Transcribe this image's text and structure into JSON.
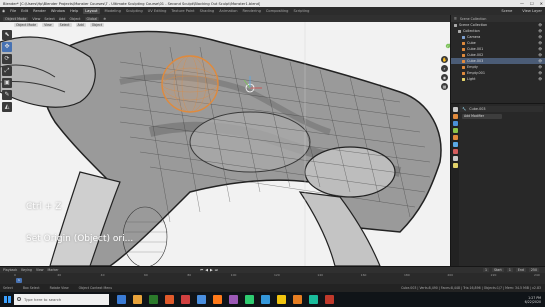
{
  "window": {
    "title": "Blender* [C:\\Users\\Hp\\Blender Projects\\Monster Courses\\7 - Ultimate Sculpting Course\\01 - Second Sculpt\\Blocking Out Sculpt\\Monster1.blend]",
    "controls": [
      "—",
      "☐",
      "✕"
    ]
  },
  "menubar": {
    "items": [
      "File",
      "Edit",
      "Render",
      "Window",
      "Help"
    ],
    "workspaces": [
      "Layout",
      "Modeling",
      "Sculpting",
      "UV Editing",
      "Texture Paint",
      "Shading",
      "Animation",
      "Rendering",
      "Compositing",
      "Scripting"
    ],
    "active_workspace": "Layout",
    "scene": "Scene",
    "view_layer": "View Layer"
  },
  "header2": {
    "mode": "Object Mode",
    "view": "View",
    "select": "Select",
    "add": "Add",
    "object": "Object",
    "orientation": "Global",
    "transform": "⊕"
  },
  "viewport": {
    "header": [
      "Object Mode",
      "View",
      "Select",
      "Add",
      "Object"
    ],
    "tools": [
      "⬉",
      "✥",
      "⟳",
      "⤢",
      "▣",
      "✎",
      "◭"
    ],
    "overlay_shortcut": "Ctrl + Z",
    "overlay_operation": "Set Origin (Object) ori...",
    "nav": [
      "✋",
      "⌕",
      "◉",
      "▦"
    ],
    "gizmo_axes": [
      "X",
      "Y",
      "Z"
    ]
  },
  "outliner": {
    "header": [
      "Scene Collection"
    ],
    "rows": [
      {
        "label": "Scene Collection",
        "type": "col",
        "indent": 0,
        "selected": false
      },
      {
        "label": "Collection",
        "type": "col",
        "indent": 1,
        "selected": false
      },
      {
        "label": "Camera",
        "type": "cam",
        "indent": 2,
        "selected": false
      },
      {
        "label": "Cube",
        "type": "mesh",
        "indent": 2,
        "selected": false
      },
      {
        "label": "Cube.001",
        "type": "mesh",
        "indent": 2,
        "selected": false
      },
      {
        "label": "Cube.002",
        "type": "mesh",
        "indent": 2,
        "selected": false
      },
      {
        "label": "Cube.003",
        "type": "mesh",
        "indent": 2,
        "selected": true
      },
      {
        "label": "Empty",
        "type": "mesh",
        "indent": 2,
        "selected": false
      },
      {
        "label": "Empty.001",
        "type": "mesh",
        "indent": 2,
        "selected": false
      },
      {
        "label": "Light",
        "type": "light",
        "indent": 2,
        "selected": false
      }
    ],
    "visibility_icon": "👁"
  },
  "properties": {
    "object_name": "Cube.003",
    "add_modifier": "Add Modifier",
    "tab_colors": [
      "#c8c8c8",
      "#e08a3c",
      "#4a90d9",
      "#8bc34a",
      "#e08a3c",
      "#5aa9e6",
      "#d45c5c",
      "#c8c8c8",
      "#e3d26a"
    ]
  },
  "timeline": {
    "menu": [
      "Playback",
      "Keying",
      "View",
      "Marker"
    ],
    "ticks": [
      "0",
      "20",
      "40",
      "60",
      "80",
      "100",
      "120",
      "140",
      "160",
      "180",
      "200",
      "220",
      "240"
    ],
    "current_frame": "1",
    "start_label": "Start",
    "start": "1",
    "end_label": "End",
    "end": "250",
    "play_controls": [
      "⏮",
      "◀",
      "▶",
      "⏭"
    ]
  },
  "statusbar": {
    "items": [
      "Select",
      "Box Select",
      "Rotate View",
      "Object Context Menu"
    ],
    "stats": "Cube.003 | Verts:8,490 | Faces:8,448 | Tris:16,896 | Objects:1/7 | Mem: 34.5 MiB | v2.83"
  },
  "taskbar": {
    "search_placeholder": "Type here to search",
    "icon_colors": [
      "#3a7bd5",
      "#e8a33b",
      "#2b7a2b",
      "#e05a2b",
      "#d04040",
      "#4a8fe0",
      "#ff7a1a",
      "#9b59b6",
      "#2ecc71",
      "#3498db",
      "#f1c40f",
      "#e67e22",
      "#1abc9c",
      "#c0392b"
    ],
    "time": "1:27 PM",
    "date": "6/22/2020"
  }
}
